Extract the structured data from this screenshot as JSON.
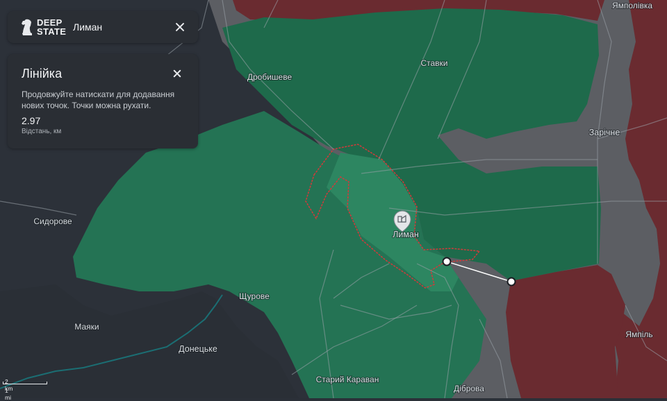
{
  "app": {
    "brand_line1": "DEEP",
    "brand_line2": "STATE",
    "place": "Лиман"
  },
  "ruler": {
    "title": "Лінійка",
    "hint": "Продовжуйте натискати для додавання нових точок. Точки можна рухати.",
    "distance": "2.97",
    "distance_unit": "Відстань, км"
  },
  "map": {
    "cities": {
      "lyman": "Лиман",
      "drobysheve": "Дробишеве",
      "stavky": "Ставки",
      "yampolivka": "Ямполівка",
      "zarichne": "Зарічне",
      "sydorove": "Сидорове",
      "shchurove": "Щурове",
      "mayaky": "Маяки",
      "donetske": "Донецьке",
      "staryi_karavan": "Старий Караван",
      "dibrova": "Діброва",
      "yampil": "Ямпіль"
    },
    "scale": {
      "metric": "2 km",
      "imperial": "1 mi"
    },
    "icons": {
      "city_marker": "city-marker-icon",
      "logo": "chess-knight-icon"
    },
    "colors": {
      "ukraine_control": "#1f6b4d",
      "liberated": "#2a7a5a",
      "occupied": "#6b2a2e",
      "gray_zone": "#5d5f64",
      "contested_outline": "#d23a3a",
      "ruler_line": "#ffffff"
    }
  }
}
